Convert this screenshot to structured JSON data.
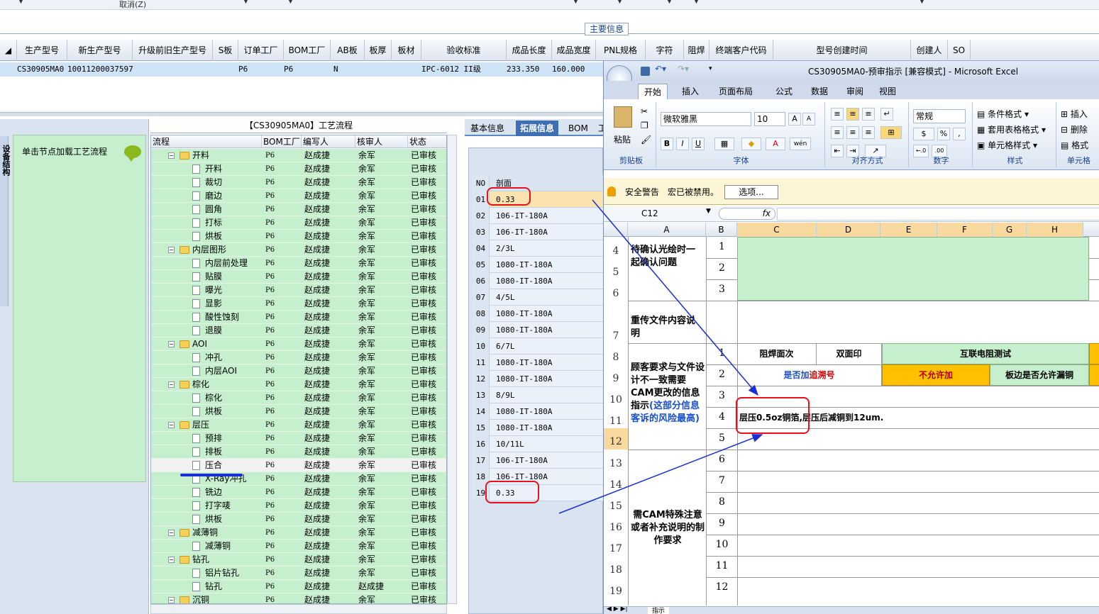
{
  "topbar": {
    "cancel_label": "取消(Z)"
  },
  "main_info_label": "主要信息",
  "grid": {
    "headers": [
      "生产型号",
      "新生产型号",
      "升级前旧生产型号",
      "S板",
      "订单工厂",
      "BOM工厂",
      "AB板",
      "板厚",
      "板材",
      "验收标准",
      "成品长度",
      "成品宽度",
      "PNL规格",
      "字符",
      "阻焊",
      "终端客户代码",
      "型号创建时间",
      "创建人",
      "SO"
    ],
    "row": {
      "model": "CS30905MA0",
      "new_model": "10011200037597",
      "order_factory": "P6",
      "bom_factory": "P6",
      "ab": "N",
      "standard": "IPC-6012 II级",
      "length": "233.350",
      "width": "160.000"
    }
  },
  "left_panel": {
    "vtab": "设备结构",
    "hint": "单击节点加载工艺流程"
  },
  "tree": {
    "title": "【CS30905MA0】工艺流程",
    "headers": [
      "流程",
      "BOM工厂",
      "编写人",
      "核审人",
      "状态"
    ],
    "rows": [
      {
        "name": "开料",
        "level": 0,
        "bom": "P6",
        "writer": "赵成捷",
        "reviewer": "余军",
        "status": "已审核"
      },
      {
        "name": "开料",
        "level": 1,
        "bom": "P6",
        "writer": "赵成捷",
        "reviewer": "余军",
        "status": "已审核"
      },
      {
        "name": "裁切",
        "level": 1,
        "bom": "P6",
        "writer": "赵成捷",
        "reviewer": "余军",
        "status": "已审核"
      },
      {
        "name": "磨边",
        "level": 1,
        "bom": "P6",
        "writer": "赵成捷",
        "reviewer": "余军",
        "status": "已审核"
      },
      {
        "name": "圆角",
        "level": 1,
        "bom": "P6",
        "writer": "赵成捷",
        "reviewer": "余军",
        "status": "已审核"
      },
      {
        "name": "打标",
        "level": 1,
        "bom": "P6",
        "writer": "赵成捷",
        "reviewer": "余军",
        "status": "已审核"
      },
      {
        "name": "烘板",
        "level": 1,
        "bom": "P6",
        "writer": "赵成捷",
        "reviewer": "余军",
        "status": "已审核"
      },
      {
        "name": "内层图形",
        "level": 0,
        "bom": "P6",
        "writer": "赵成捷",
        "reviewer": "余军",
        "status": "已审核"
      },
      {
        "name": "内层前处理",
        "level": 1,
        "bom": "P6",
        "writer": "赵成捷",
        "reviewer": "余军",
        "status": "已审核"
      },
      {
        "name": "贴膜",
        "level": 1,
        "bom": "P6",
        "writer": "赵成捷",
        "reviewer": "余军",
        "status": "已审核"
      },
      {
        "name": "曝光",
        "level": 1,
        "bom": "P6",
        "writer": "赵成捷",
        "reviewer": "余军",
        "status": "已审核"
      },
      {
        "name": "显影",
        "level": 1,
        "bom": "P6",
        "writer": "赵成捷",
        "reviewer": "余军",
        "status": "已审核"
      },
      {
        "name": "酸性蚀刻",
        "level": 1,
        "bom": "P6",
        "writer": "赵成捷",
        "reviewer": "余军",
        "status": "已审核"
      },
      {
        "name": "退膜",
        "level": 1,
        "bom": "P6",
        "writer": "赵成捷",
        "reviewer": "余军",
        "status": "已审核"
      },
      {
        "name": "AOI",
        "level": 0,
        "bom": "P6",
        "writer": "赵成捷",
        "reviewer": "余军",
        "status": "已审核"
      },
      {
        "name": "冲孔",
        "level": 1,
        "bom": "P6",
        "writer": "赵成捷",
        "reviewer": "余军",
        "status": "已审核"
      },
      {
        "name": "内层AOI",
        "level": 1,
        "bom": "P6",
        "writer": "赵成捷",
        "reviewer": "余军",
        "status": "已审核"
      },
      {
        "name": "棕化",
        "level": 0,
        "bom": "P6",
        "writer": "赵成捷",
        "reviewer": "余军",
        "status": "已审核"
      },
      {
        "name": "棕化",
        "level": 1,
        "bom": "P6",
        "writer": "赵成捷",
        "reviewer": "余军",
        "status": "已审核"
      },
      {
        "name": "烘板",
        "level": 1,
        "bom": "P6",
        "writer": "赵成捷",
        "reviewer": "余军",
        "status": "已审核"
      },
      {
        "name": "层压",
        "level": 0,
        "bom": "P6",
        "writer": "赵成捷",
        "reviewer": "余军",
        "status": "已审核"
      },
      {
        "name": "预排",
        "level": 1,
        "bom": "P6",
        "writer": "赵成捷",
        "reviewer": "余军",
        "status": "已审核"
      },
      {
        "name": "排板",
        "level": 1,
        "bom": "P6",
        "writer": "赵成捷",
        "reviewer": "余军",
        "status": "已审核"
      },
      {
        "name": "压合",
        "level": 1,
        "bom": "P6",
        "writer": "赵成捷",
        "reviewer": "余军",
        "status": "已审核",
        "selected": true
      },
      {
        "name": "X-Ray冲孔",
        "level": 1,
        "bom": "P6",
        "writer": "赵成捷",
        "reviewer": "余军",
        "status": "已审核"
      },
      {
        "name": "铣边",
        "level": 1,
        "bom": "P6",
        "writer": "赵成捷",
        "reviewer": "余军",
        "status": "已审核"
      },
      {
        "name": "打字唛",
        "level": 1,
        "bom": "P6",
        "writer": "赵成捷",
        "reviewer": "余军",
        "status": "已审核"
      },
      {
        "name": "烘板",
        "level": 1,
        "bom": "P6",
        "writer": "赵成捷",
        "reviewer": "余军",
        "status": "已审核"
      },
      {
        "name": "减薄铜",
        "level": 0,
        "bom": "P6",
        "writer": "赵成捷",
        "reviewer": "余军",
        "status": "已审核"
      },
      {
        "name": "减薄铜",
        "level": 1,
        "bom": "P6",
        "writer": "赵成捷",
        "reviewer": "余军",
        "status": "已审核"
      },
      {
        "name": "钻孔",
        "level": 0,
        "bom": "P6",
        "writer": "赵成捷",
        "reviewer": "余军",
        "status": "已审核"
      },
      {
        "name": "铝片钻孔",
        "level": 1,
        "bom": "P6",
        "writer": "赵成捷",
        "reviewer": "余军",
        "status": "已审核"
      },
      {
        "name": "钻孔",
        "level": 1,
        "bom": "P6",
        "writer": "赵成捷",
        "reviewer": "赵成捷",
        "status": "已审核"
      },
      {
        "name": "沉铜",
        "level": 0,
        "bom": "P6",
        "writer": "赵成捷",
        "reviewer": "余军",
        "status": "已审核"
      }
    ]
  },
  "right_tabs": [
    "基本信息",
    "拓展信息",
    "BOM",
    "工"
  ],
  "cross": {
    "headers": [
      "NO",
      "剖面"
    ],
    "rows": [
      {
        "no": "01",
        "p": "0.33"
      },
      {
        "no": "02",
        "p": "106-IT-180A"
      },
      {
        "no": "03",
        "p": "106-IT-180A"
      },
      {
        "no": "04",
        "p": "2/3L"
      },
      {
        "no": "05",
        "p": "1080-IT-180A"
      },
      {
        "no": "06",
        "p": "1080-IT-180A"
      },
      {
        "no": "07",
        "p": "4/5L"
      },
      {
        "no": "08",
        "p": "1080-IT-180A"
      },
      {
        "no": "09",
        "p": "1080-IT-180A"
      },
      {
        "no": "10",
        "p": "6/7L"
      },
      {
        "no": "11",
        "p": "1080-IT-180A"
      },
      {
        "no": "12",
        "p": "1080-IT-180A"
      },
      {
        "no": "13",
        "p": "8/9L"
      },
      {
        "no": "14",
        "p": "1080-IT-180A"
      },
      {
        "no": "15",
        "p": "1080-IT-180A"
      },
      {
        "no": "16",
        "p": "10/11L"
      },
      {
        "no": "17",
        "p": "106-IT-180A"
      },
      {
        "no": "18",
        "p": "106-IT-180A"
      },
      {
        "no": "19",
        "p": "0.33"
      }
    ]
  },
  "excel": {
    "title": "CS30905MA0-预审指示 [兼容模式] - Microsoft Excel",
    "tabs": [
      "开始",
      "插入",
      "页面布局",
      "公式",
      "数据",
      "审阅",
      "视图"
    ],
    "ribbon": {
      "paste": "粘贴",
      "clipboard": "剪贴板",
      "font_name": "微软雅黑",
      "font_size": "10",
      "font": "字体",
      "align": "对齐方式",
      "num_format": "常规",
      "number": "数字",
      "cond": "条件格式",
      "table": "套用表格格式",
      "cellstyle": "单元格样式",
      "styles": "样式",
      "insert": "插入",
      "delete": "删除",
      "format": "格式",
      "cells": "单元格",
      "bold": "B",
      "italic": "I",
      "underline": "U",
      "fontcolor": "A",
      "wen": "wén",
      "pct": "%",
      "comma": ",",
      "grow": "A",
      "shrink": "A",
      "dec_inc": "←.0",
      "dec_dec": ".00"
    },
    "security": {
      "label": "安全警告",
      "msg": "宏已被禁用。",
      "button": "选项..."
    },
    "name_box": "C12",
    "fx": "fx",
    "columns": [
      "A",
      "B",
      "C",
      "D",
      "E",
      "F",
      "G",
      "H"
    ],
    "row_numbers": [
      "4",
      "5",
      "6",
      "7",
      "8",
      "9",
      "10",
      "11",
      "12",
      "13",
      "14",
      "15",
      "16",
      "17",
      "18",
      "19"
    ],
    "labels": {
      "confirm": "待确认光绘时一起确认问题",
      "reupload": "重传文件内容说明",
      "cust_a": "顾客要求与文件设计不一致需要CAM更改的信息指示",
      "cust_b": "(这部分信息客诉的风险最高)",
      "special": "需CAM特殊注意或者补充说明的制作要求"
    },
    "b_numbers": [
      "1",
      "2",
      "3",
      "1",
      "2",
      "3",
      "4",
      "5",
      "6",
      "7",
      "8",
      "9",
      "10",
      "11",
      "12"
    ],
    "cells": {
      "solder": "阻焊面次",
      "double": "双面印",
      "impedance": "互联电阻测试",
      "trace_a": "是否加",
      "trace_b": "追溯号",
      "notallow": "不允许加",
      "edge": "板边是否允许漏铜",
      "note_a": "层压0.5oz铜箔,",
      "note_b": "层压后减铜到12um."
    },
    "sheet_tab": "指示"
  },
  "colors": {
    "green": "#c6efce",
    "orange": "#ffc000",
    "red": "#e8101c",
    "arrow": "#1a2fd6",
    "accent": "#3e6fb4"
  }
}
